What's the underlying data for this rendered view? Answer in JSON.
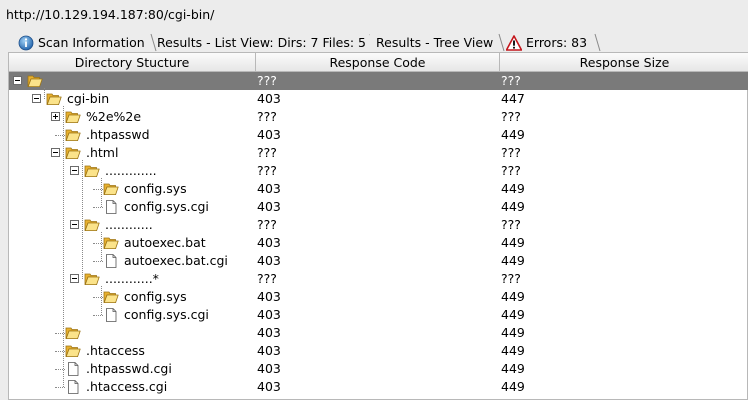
{
  "url": "http://10.129.194.187:80/cgi-bin/",
  "tabs": [
    {
      "label": "Scan Information",
      "icon": "info-icon"
    },
    {
      "label": "Results - List View: Dirs: 7 Files: 5",
      "icon": ""
    },
    {
      "label": "Results - Tree View",
      "icon": "",
      "active": true
    },
    {
      "label": "Errors: 83",
      "icon": "warning-icon"
    }
  ],
  "columns": [
    "Directory Stucture",
    "Response Code",
    "Response Size"
  ],
  "rows": [
    {
      "name": "",
      "type": "folder",
      "code": "???",
      "size": "???"
    },
    {
      "name": "cgi-bin",
      "type": "folder",
      "code": "403",
      "size": "447"
    },
    {
      "name": "%2e%2e",
      "type": "folder",
      "code": "???",
      "size": "???"
    },
    {
      "name": ".htpasswd",
      "type": "folder",
      "code": "403",
      "size": "449"
    },
    {
      "name": ".html",
      "type": "folder",
      "code": "???",
      "size": "???"
    },
    {
      "name": ".............",
      "type": "folder",
      "code": "???",
      "size": "???"
    },
    {
      "name": "config.sys",
      "type": "folder",
      "code": "403",
      "size": "449"
    },
    {
      "name": "config.sys.cgi",
      "type": "file",
      "code": "403",
      "size": "449"
    },
    {
      "name": "............",
      "type": "folder",
      "code": "???",
      "size": "???"
    },
    {
      "name": "autoexec.bat",
      "type": "folder",
      "code": "403",
      "size": "449"
    },
    {
      "name": "autoexec.bat.cgi",
      "type": "file",
      "code": "403",
      "size": "449"
    },
    {
      "name": "............*",
      "type": "folder",
      "code": "???",
      "size": "???"
    },
    {
      "name": "config.sys",
      "type": "folder",
      "code": "403",
      "size": "449"
    },
    {
      "name": "config.sys.cgi",
      "type": "file",
      "code": "403",
      "size": "449"
    },
    {
      "name": "",
      "type": "folder",
      "code": "403",
      "size": "449"
    },
    {
      "name": ".htaccess",
      "type": "folder",
      "code": "403",
      "size": "449"
    },
    {
      "name": ".htpasswd.cgi",
      "type": "file",
      "code": "403",
      "size": "449"
    },
    {
      "name": ".htaccess.cgi",
      "type": "file",
      "code": "403",
      "size": "449"
    }
  ]
}
